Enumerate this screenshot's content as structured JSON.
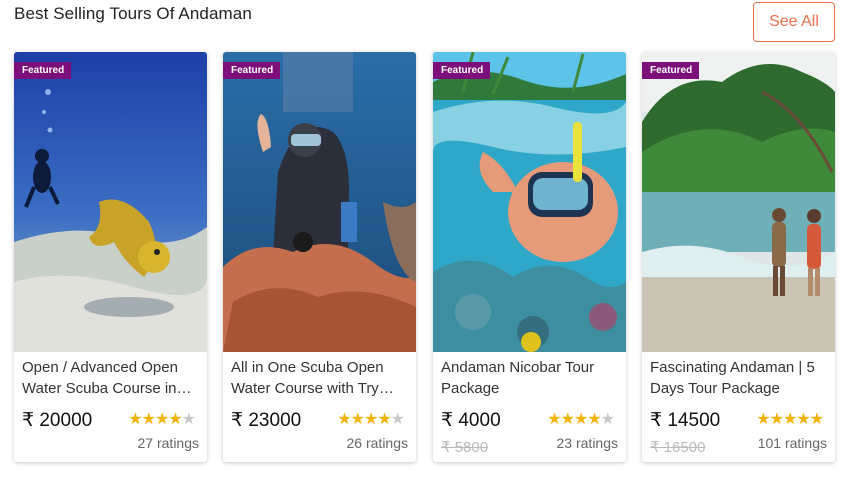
{
  "header": {
    "title": "Best Selling Tours Of Andaman",
    "see_all_label": "See All"
  },
  "colors": {
    "accent": "#e8704a",
    "badge": "#7d0f7a",
    "star": "#f5b301"
  },
  "cards": [
    {
      "badge": "Featured",
      "title": "Open / Advanced Open Water Scuba Course in Havelock",
      "price": "₹ 20000",
      "old_price": "",
      "stars": "★★★★",
      "stars_off": "★",
      "rating_value": 4,
      "ratings": "27 ratings"
    },
    {
      "badge": "Featured",
      "title": "All in One Scuba Open Water Course with Try Dive",
      "price": "₹ 23000",
      "old_price": "",
      "stars": "★★★★",
      "stars_off": "★",
      "rating_value": 4,
      "ratings": "26 ratings"
    },
    {
      "badge": "Featured",
      "title": "Andaman Nicobar Tour Package",
      "price": "₹ 4000",
      "old_price": "₹ 5800",
      "stars": "★★★★",
      "stars_off": "★",
      "rating_value": 4,
      "ratings": "23 ratings"
    },
    {
      "badge": "Featured",
      "title": "Fascinating Andaman | 5 Days Tour Package",
      "price": "₹ 14500",
      "old_price": "₹ 16500",
      "stars": "★★★★★",
      "stars_off": "",
      "rating_value": 5,
      "ratings": "101 ratings"
    }
  ]
}
